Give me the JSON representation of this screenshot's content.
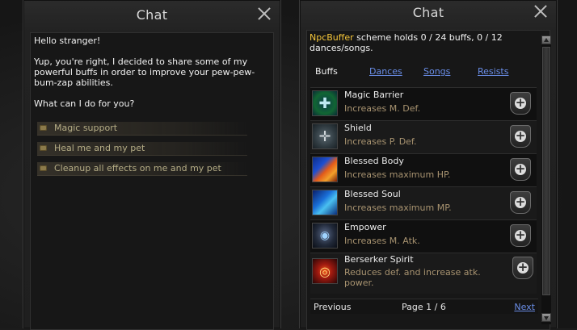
{
  "left_window": {
    "title": "Chat",
    "message": "Hello stranger!\n\nYup, you're right, I decided to share some of my powerful buffs in order to improve your pew-pew-bum-zap abilities.\n\nWhat can I do for you?",
    "options": [
      {
        "label": "Magic support"
      },
      {
        "label": "Heal me and my pet"
      },
      {
        "label": "Cleanup all effects on me and my pet"
      }
    ]
  },
  "right_window": {
    "title": "Chat",
    "npc_name": "NpcBuffer",
    "scheme_text": " scheme holds 0 / 24 buffs, 0 / 12 dances/songs.",
    "tabs": {
      "current": "Buffs",
      "dances": "Dances",
      "songs": "Songs",
      "resists": "Resists"
    },
    "skills": [
      {
        "name": "Magic Barrier",
        "desc": "Increases M. Def.",
        "icon": "magic-barrier-icon"
      },
      {
        "name": "Shield",
        "desc": "Increases P. Def.",
        "icon": "shield-icon"
      },
      {
        "name": "Blessed Body",
        "desc": "Increases maximum HP.",
        "icon": "blessed-body-icon"
      },
      {
        "name": "Blessed Soul",
        "desc": "Increases maximum MP.",
        "icon": "blessed-soul-icon"
      },
      {
        "name": "Empower",
        "desc": "Increases M. Atk.",
        "icon": "empower-icon"
      },
      {
        "name": "Berserker Spirit",
        "desc": "Reduces def. and increase atk. power.",
        "icon": "berserker-spirit-icon"
      }
    ],
    "pager": {
      "previous": "Previous",
      "page": "Page 1 / 6",
      "next": "Next"
    }
  }
}
